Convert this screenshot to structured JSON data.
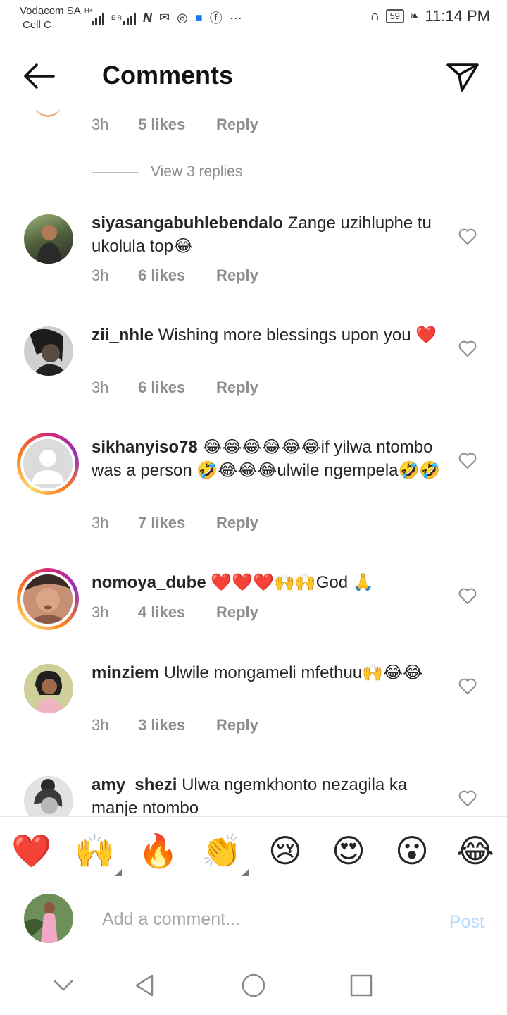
{
  "status_bar": {
    "carrier_1": "Vodacom SA",
    "carrier_2": "Cell C",
    "net_1": "H+",
    "net_2": "E R",
    "battery": "59",
    "time": "11:14 PM"
  },
  "header": {
    "title": "Comments"
  },
  "top_reply_row": {
    "time": "3h",
    "likes": "5 likes",
    "reply": "Reply"
  },
  "view_replies": "View 3 replies",
  "comments": [
    {
      "user": "siyasangabuhlebendalo",
      "text": "Zange uzihluphe tu ukolula top😂",
      "time": "3h",
      "likes": "6 likes",
      "reply": "Reply"
    },
    {
      "user": "zii_nhle",
      "text": "Wishing more blessings upon you ❤️",
      "time": "3h",
      "likes": "6 likes",
      "reply": "Reply"
    },
    {
      "user": "sikhanyiso78",
      "text": "😂😂😂😂😂😂if yilwa ntombo was a person 🤣😂😂😂ulwile ngempela🤣🤣",
      "time": "3h",
      "likes": "7 likes",
      "reply": "Reply"
    },
    {
      "user": "nomoya_dube",
      "text": "❤️❤️❤️🙌🙌God 🙏",
      "time": "3h",
      "likes": "4 likes",
      "reply": "Reply"
    },
    {
      "user": "minziem",
      "text": "Ulwile mongameli mfethuu🙌😂😂",
      "time": "3h",
      "likes": "3 likes",
      "reply": "Reply"
    },
    {
      "user": "amy_shezi",
      "text": "Ulwa ngemkhonto nezagila ka manje ntombo"
    }
  ],
  "emoji_bar": [
    "❤️",
    "🙌",
    "🔥",
    "👏",
    "😢",
    "😍",
    "😮",
    "😂"
  ],
  "composer": {
    "placeholder": "Add a comment...",
    "post_label": "Post"
  },
  "colors": {
    "post_disabled": "#b3dbff",
    "meta_gray": "#8e8e8e",
    "heart_red": "#e0152d"
  }
}
